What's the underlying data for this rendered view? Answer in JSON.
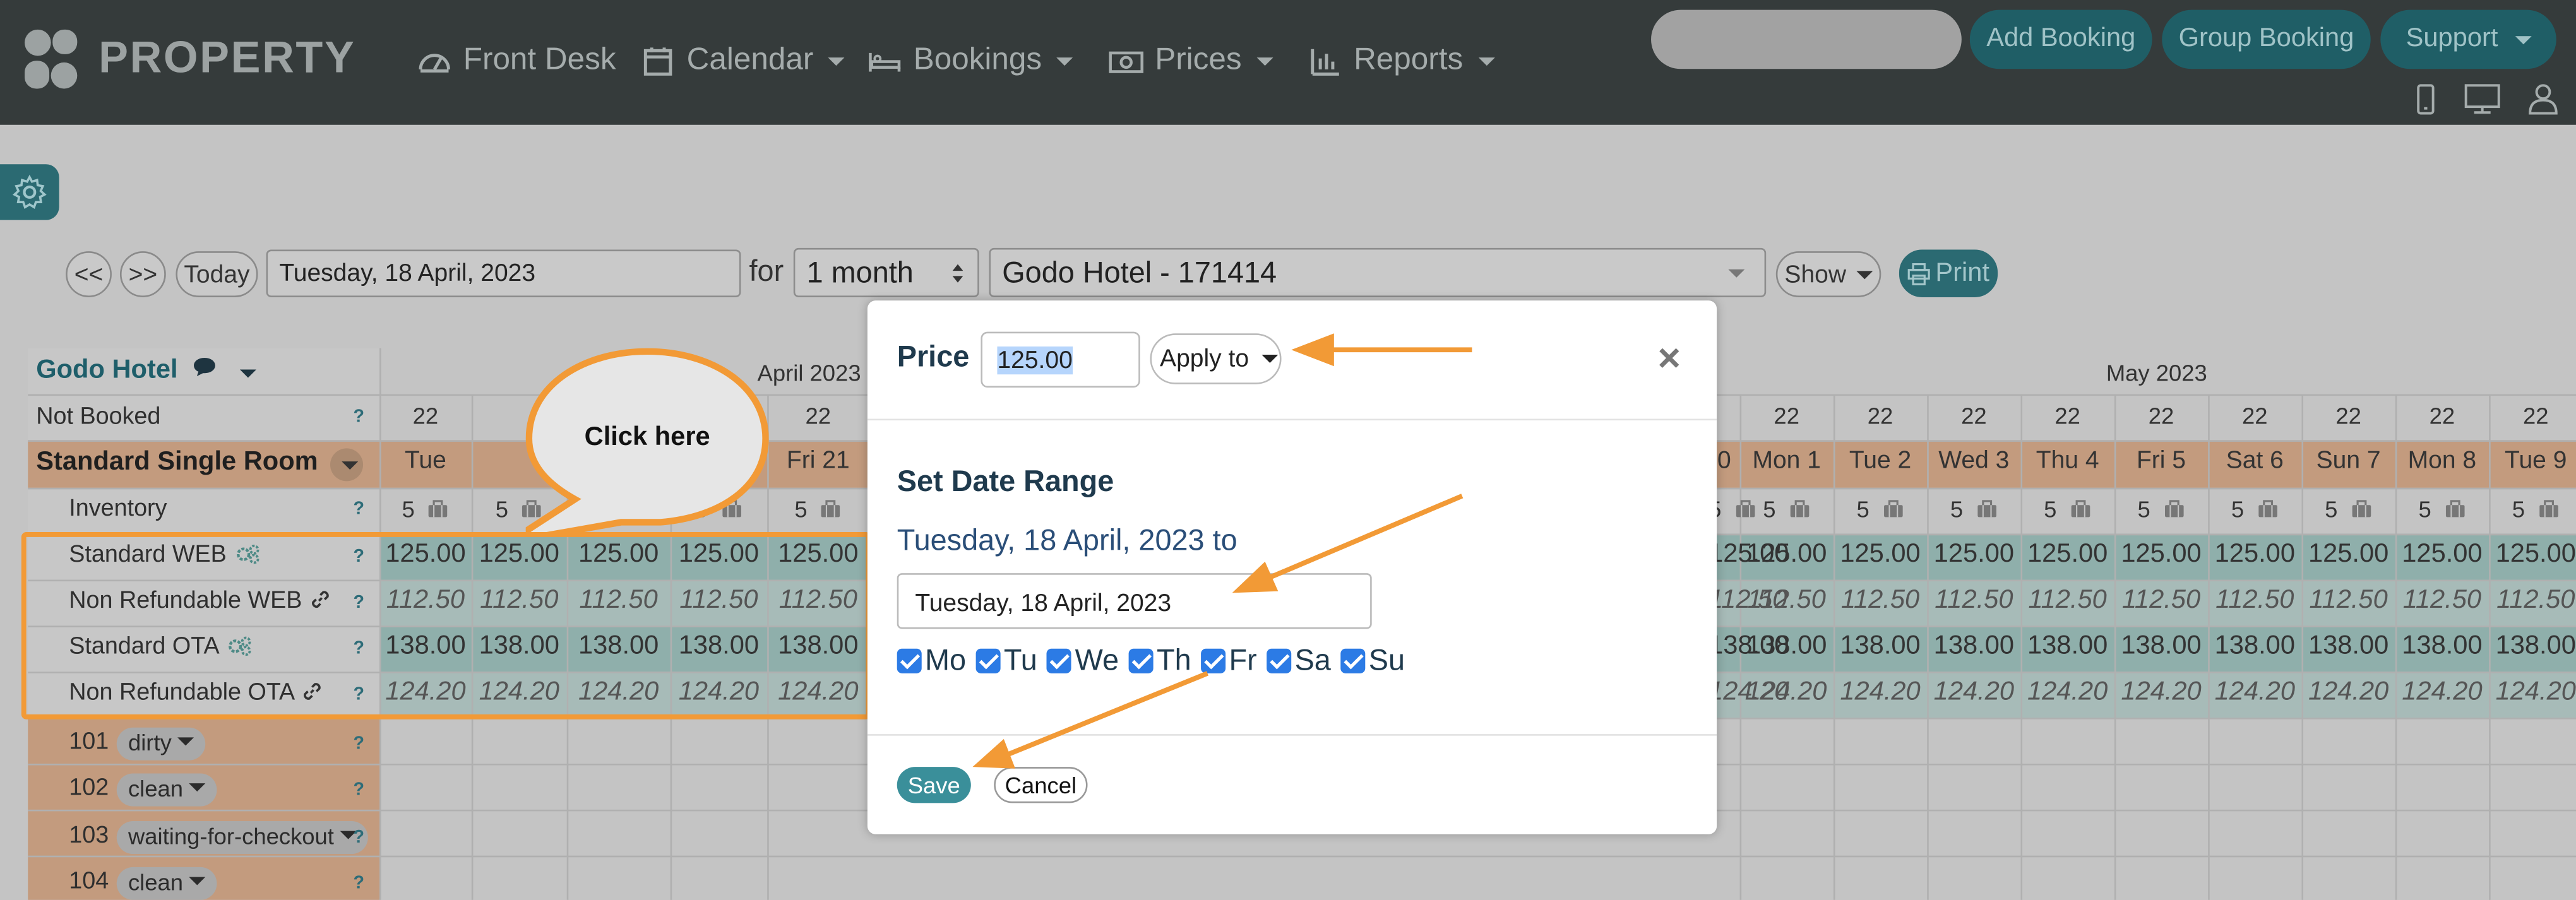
{
  "nav": {
    "brand": "PROPERTY",
    "items": [
      {
        "label": "Front Desk",
        "icon": "dashboard-icon",
        "caret": false
      },
      {
        "label": "Calendar",
        "icon": "calendar-icon",
        "caret": true
      },
      {
        "label": "Bookings",
        "icon": "bed-icon",
        "caret": true
      },
      {
        "label": "Prices",
        "icon": "money-icon",
        "caret": true
      },
      {
        "label": "Reports",
        "icon": "bar-chart-icon",
        "caret": true
      }
    ],
    "search_placeholder": "",
    "add_booking": "Add Booking",
    "group_booking": "Group Booking",
    "support": "Support"
  },
  "toolbar": {
    "prev": "<<",
    "next": ">>",
    "today": "Today",
    "date": "Tuesday, 18 April, 2023",
    "for_label": "for",
    "period": "1 month",
    "property": "Godo Hotel - 171414",
    "show": "Show",
    "print": "Print"
  },
  "grid": {
    "property_name": "Godo Hotel",
    "not_booked": "Not Booked",
    "month_left": "April 2023",
    "month_right": "May 2023",
    "room_type": "Standard Single Room",
    "rows": {
      "inventory": "Inventory",
      "standard_web": "Standard WEB",
      "nonref_web": "Non Refundable WEB",
      "standard_ota": "Standard OTA",
      "nonref_ota": "Non Refundable OTA"
    },
    "rooms": [
      {
        "number": "101",
        "status": "dirty"
      },
      {
        "number": "102",
        "status": "clean"
      },
      {
        "number": "103",
        "status": "waiting-for-checkout"
      },
      {
        "number": "104",
        "status": "clean"
      }
    ],
    "help": "?",
    "left_days": [
      "Tue",
      "",
      "",
      "",
      "Fri 21"
    ],
    "left_counts": [
      "22",
      "",
      "",
      "",
      "22"
    ],
    "right_days": [
      "0",
      "Mon 1",
      "Tue 2",
      "Wed 3",
      "Thu 4",
      "Fri 5",
      "Sat 6",
      "Sun 7",
      "Mon 8",
      "Tue 9"
    ],
    "right_counts": [
      "",
      "22",
      "22",
      "22",
      "22",
      "22",
      "22",
      "22",
      "22",
      "22"
    ],
    "inventory_value": "5",
    "price_standard_web": "125.00",
    "price_nonref_web": "112.50",
    "price_standard_ota": "138.00",
    "price_nonref_ota": "124.20"
  },
  "callout": {
    "text": "Click here"
  },
  "modal": {
    "price_label": "Price",
    "price_value": "125.00",
    "apply_to": "Apply to",
    "close": "×",
    "date_range_title": "Set Date Range",
    "range_text": "Tuesday, 18 April, 2023 to",
    "end_date": "Tuesday, 18 April, 2023",
    "days": [
      "Mo",
      "Tu",
      "We",
      "Th",
      "Fr",
      "Sa",
      "Su"
    ],
    "save": "Save",
    "cancel": "Cancel"
  },
  "colors": {
    "nav_bg": "#353b3b",
    "accent": "#2b6a72",
    "arrow": "#f29a36",
    "room_row": "#c39b7e",
    "price_row": "#8fafab"
  }
}
